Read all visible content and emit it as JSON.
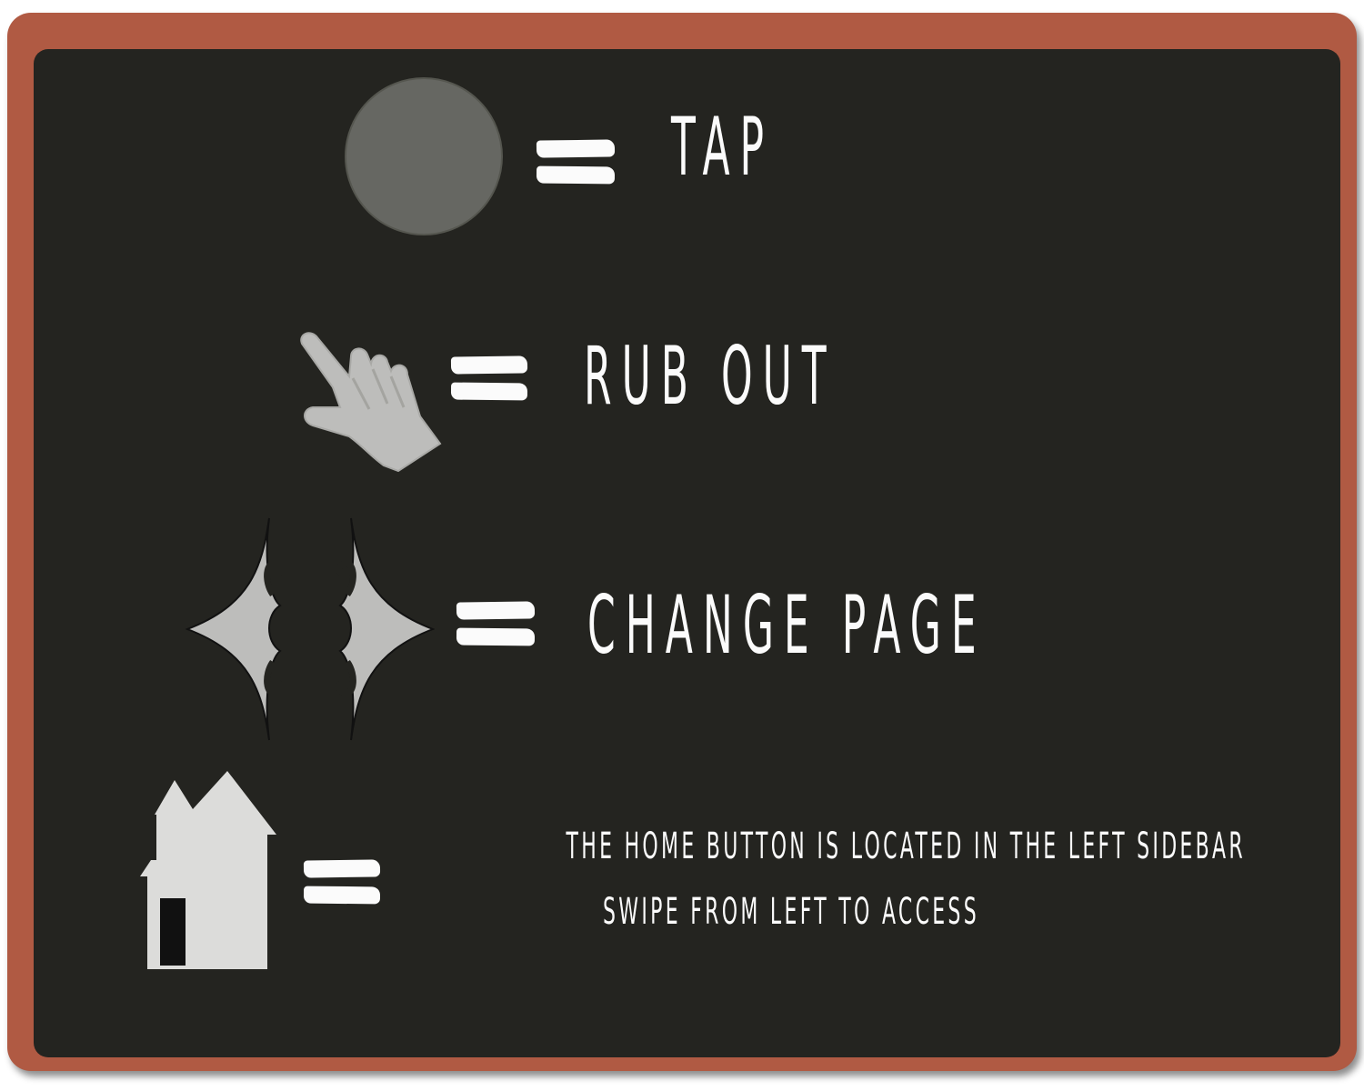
{
  "gestures": [
    {
      "icon": "tap-circle-icon",
      "label": "TAP"
    },
    {
      "icon": "pointing-hand-icon",
      "label": "RUB OUT"
    },
    {
      "icon": "page-arrows-icon",
      "label": "CHANGE PAGE"
    }
  ],
  "home": {
    "icon": "house-icon",
    "line1": "THE HOME BUTTON IS LOCATED IN THE LEFT SIDEBAR",
    "line2": "SWIPE FROM LEFT TO ACCESS"
  },
  "colors": {
    "frame": "#b05a43",
    "board": "#242420",
    "chalk": "#fbfbfb",
    "icon_gray": "#bdbdbb",
    "circle_gray": "#666762"
  }
}
